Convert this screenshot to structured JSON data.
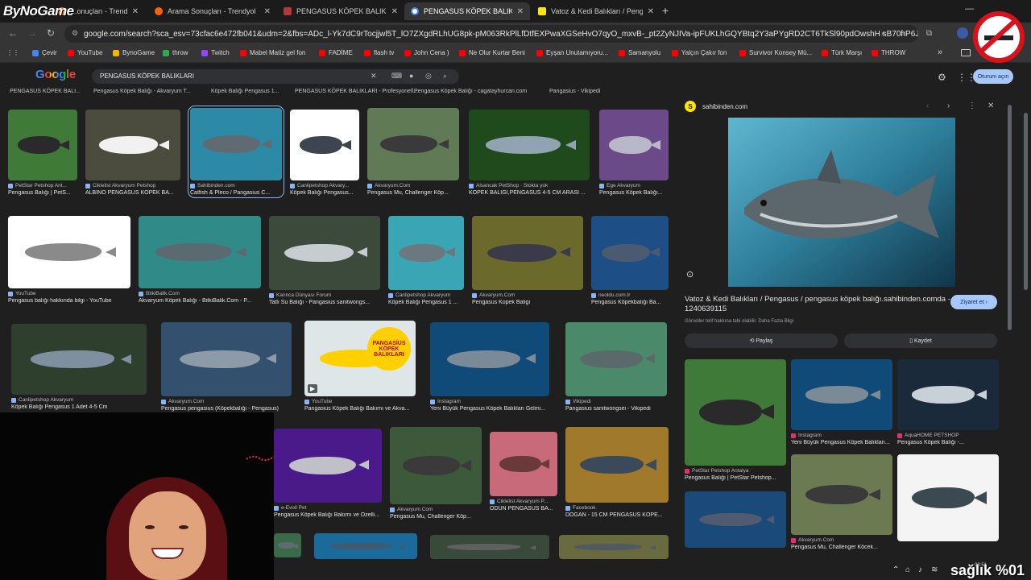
{
  "overlay": {
    "channel_logo": "ByNoGame",
    "bottom_text": "sağlık %01"
  },
  "browser": {
    "tabs": [
      {
        "title": "...onuçları - Trendyol",
        "favicon": "trendyol-icon",
        "active": false
      },
      {
        "title": "Arama Sonuçları - Trendyol",
        "favicon": "trendyol-icon",
        "active": false
      },
      {
        "title": "PENGASUS KÖPEK BALIKLARI",
        "favicon": "site-icon",
        "active": false
      },
      {
        "title": "PENGASUS KÖPEK BALIKLARI -",
        "favicon": "google-icon",
        "active": true
      },
      {
        "title": "Vatoz & Kedi Balıkları / Pengas",
        "favicon": "sahibinden-icon",
        "active": false
      }
    ],
    "url": "google.com/search?sca_esv=73cfac6e472fb041&udm=2&fbs=ADc_l-Yk7dC9rTocjjwl5T_lO7ZXgdRLhUG8pk-pM063RkPlLfDtfEXPwaXGSeHvO7qyO_mxvB-_pt2ZyNJIVa-ipFUKLhGQYBtq2Y3aPYgRD2CT6TkSl90pdOwshH sB70hP6J645WLRN...",
    "bookmarks": [
      {
        "label": "Çevir",
        "color": "#4285f4"
      },
      {
        "label": "YouTube",
        "color": "#ff0000"
      },
      {
        "label": "BynoGame",
        "color": "#f4b400"
      },
      {
        "label": "throw",
        "color": "#34a853"
      },
      {
        "label": "Twitch",
        "color": "#9146ff"
      },
      {
        "label": "Mabel Matiz  gel fon",
        "color": "#ff0000"
      },
      {
        "label": "FADİME",
        "color": "#ff0000"
      },
      {
        "label": "flash tv",
        "color": "#ff0000"
      },
      {
        "label": "John Cena )",
        "color": "#ff0000"
      },
      {
        "label": "Ne Olur Kurtar Beni",
        "color": "#ff0000"
      },
      {
        "label": "Eyşan Unutamıyoru...",
        "color": "#ff0000"
      },
      {
        "label": "Samanyolu",
        "color": "#ff0000"
      },
      {
        "label": "Yalçın Çakır fon",
        "color": "#ff0000"
      },
      {
        "label": "Survivor Konsey Mü...",
        "color": "#ff0000"
      },
      {
        "label": "Türk Marşı",
        "color": "#ff0000"
      },
      {
        "label": "THROW",
        "color": "#ff0000"
      }
    ]
  },
  "google": {
    "logo": "Google",
    "query": "PENGASUS KÖPEK BALIKLARI",
    "signin_label": "Oturum açın",
    "chips": [
      "PENGASUS KÖPEK BALI...",
      "Pengasus Köpek Balığı - Akvaryum T...",
      "Köpek Balığı Pengasus 1...",
      "PENGASUS KÖPEK BALIKLARI - Profesyonell...",
      "Pengasus Köpek Balığı - cagatayhurcan.com",
      "Pangasius - Vikipedi"
    ]
  },
  "results": [
    {
      "source": "PetStar Petshop Ant...",
      "title": "Pengasus Balığı | PetS...",
      "bg": "#3f7a38",
      "fish": "#2a2a2a"
    },
    {
      "source": "Ciklelist Akvaryum Petshop",
      "title": "ALBİNO PENGASUS KÖPEK BA...",
      "bg": "#4b4b3e",
      "fish": "#f1f1f1"
    },
    {
      "source": "Sahibinden.com",
      "title": "Catfish & Pleco / Pangasius C...",
      "bg": "#2d8aa6",
      "fish": "#5f6a72"
    },
    {
      "source": "Canlipetshop Akvary...",
      "title": "Köpek Balığı Pengasus...",
      "bg": "#ffffff",
      "fish": "#3d4650"
    },
    {
      "source": "Akvaryum.Com",
      "title": "Pengasus Mu, Challenger Köp...",
      "bg": "#607a55",
      "fish": "#3a3a3a"
    },
    {
      "source": "Alsancak PetShop · Stokta yok",
      "title": "KÖPEK BALIĞI,PENGASUS 4-5 CM ARASI ...",
      "bg": "#1f4b1c",
      "fish": "#8fa3b0"
    },
    {
      "source": "Ege Akvaryum",
      "title": "Pengasus Köpek Balığı...",
      "bg": "#6c4a8a",
      "fish": "#b8b8c8"
    },
    {
      "source": "YouTube",
      "title": "Pengasus balığı hakkında bilgi - YouTube",
      "bg": "#ffffff",
      "fish": "#8a8a8a"
    },
    {
      "source": "BitkiBalik.Com",
      "title": "Akvaryum Köpek Balığı - BitkiBalik.Com - P...",
      "bg": "#2f8a88",
      "fish": "#5a6a70"
    },
    {
      "source": "Kannca Dünyası Forum",
      "title": "Tatlı Su Balığı - Pangasius sanitwongs...",
      "bg": "#3b4a3a",
      "fish": "#c7ccd0"
    },
    {
      "source": "Canlipetshop Akvaryum",
      "title": "Köpek Balığı Pengasus 1 ...",
      "bg": "#3aa5b5",
      "fish": "#6c7880"
    },
    {
      "source": "Akvaryum.Com",
      "title": "Pengasus Kopek Baligi",
      "bg": "#6b6a2a",
      "fish": "#3a3a4a"
    },
    {
      "source": "neoldu.com.tr",
      "title": "Pengasus Köpekbalığı Ba...",
      "bg": "#1e4e86",
      "fish": "#4a5a70"
    },
    {
      "source": "Canlipetshop Akvaryum",
      "title": "Köpek Balığı Pengasus 1 Adet 4-5 Cm",
      "bg": "#2f3f2e",
      "fish": "#7e8fa0"
    },
    {
      "source": "Akvaryum.Com",
      "title": "Pengasus pengasius (Köpekbalığı - Pengasus)",
      "bg": "#33506e",
      "fish": "#8d9aa7"
    },
    {
      "source": "YouTube",
      "title": "Pangasius Köpek Balığı Bakımı ve Akva...",
      "bg": "#dfe6e8",
      "fish": "#ffd000"
    },
    {
      "source": "Instagram",
      "title": "Yeni Büyük Pengasus Köpek Balıkları Gelmi...",
      "bg": "#0f4a78",
      "fish": "#7a8a96"
    },
    {
      "source": "Vikipedi",
      "title": "Pangasius sanitwongsei - Vikipedi",
      "bg": "#4a8a6a",
      "fish": "#5a6a6a"
    },
    {
      "source": "e-Evoil Pet",
      "title": "Pengasus Köpek Balığı Bakımı ve Özelli...",
      "bg": "#4a1a8a",
      "fish": "#c0c0c8"
    },
    {
      "source": "Akvaryum.Com",
      "title": "Pengasus Mu, Challenger Köp...",
      "bg": "#3c5a3a",
      "fish": "#3a3a3a"
    },
    {
      "source": "Ciklelist Akvaryum P...",
      "title": "ODUN PENGASUS BA...",
      "bg": "#c86a7a",
      "fish": "#6a3a3a"
    },
    {
      "source": "Facebook",
      "title": "DOĞAN - 15 CM PENGASUS KÖPE...",
      "bg": "#a07a2a",
      "fish": "#3a4a5a"
    },
    {
      "source": "",
      "title": "",
      "bg": "#3a6a4a",
      "fish": "#606a70"
    },
    {
      "source": "",
      "title": "",
      "bg": "#1a6a9a",
      "fish": "#405a70"
    },
    {
      "source": "",
      "title": "",
      "bg": "#3a4a3a",
      "fish": "#606060"
    },
    {
      "source": "",
      "title": "",
      "bg": "#6a6a40",
      "fish": "#505a60"
    }
  ],
  "youtube_thumb_caption": "PANGASİUS KÖPEK BALIKLARI",
  "preview": {
    "site": "sahibinden.com",
    "site_initial": "S",
    "title": "Vatoz & Kedi Balıkları / Pengasus / pengasus köpek balığı.sahibinden.comda - 1240639115",
    "visit_label": "Ziyaret et",
    "copyright_note": "Görseller telif hakkına tabi olabilir. Daha Fazla Bilgi",
    "share_label": "Paylaş",
    "save_label": "Kaydet",
    "related": [
      {
        "source": "PetStar Petshop Antalya",
        "title": "Pengasus Balığı | PetStar Petshop...",
        "bg": "#3f7a38",
        "fish": "#2a2a2a"
      },
      {
        "source": "Instagram",
        "title": "Yeni Büyük Pengasus Köpek Balıkları...",
        "bg": "#0f4a78",
        "fish": "#7a8a96"
      },
      {
        "source": "AquaHOME PETSHOP",
        "title": "Pengasus Köpek Balığı -...",
        "bg": "#1a2a3a",
        "fish": "#c8d0d8"
      },
      {
        "source": "",
        "title": "",
        "bg": "#1a4a7a",
        "fish": "#505a70"
      },
      {
        "source": "Akvaryum.Com",
        "title": "Pengasus Mu, Challenger Köcek...",
        "bg": "#6b7a50",
        "fish": "#3a3a3a"
      },
      {
        "source": "",
        "title": "",
        "bg": "#f4f4f4",
        "fish": "#3a4a50"
      }
    ]
  },
  "tray": {
    "time": "03:51"
  }
}
